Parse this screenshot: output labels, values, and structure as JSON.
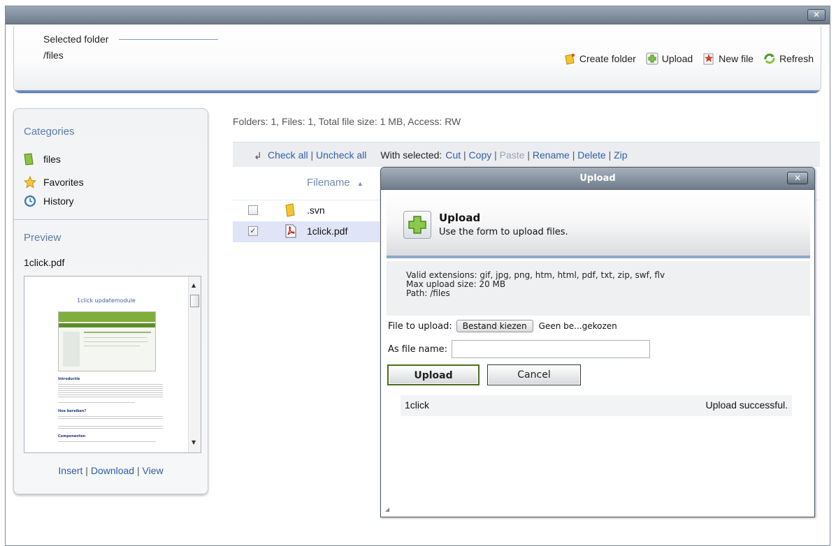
{
  "window": {
    "close_label": "✕"
  },
  "header": {
    "selected_folder_label": "Selected folder",
    "selected_folder_value": "/files",
    "toolbar": {
      "create_folder": "Create folder",
      "upload": "Upload",
      "new_file": "New file",
      "refresh": "Refresh"
    }
  },
  "sidebar": {
    "categories_title": "Categories",
    "items": [
      {
        "label": "files",
        "icon": "folder-icon"
      },
      {
        "label": "Favorites",
        "icon": "star-icon"
      },
      {
        "label": "History",
        "icon": "clock-icon"
      }
    ],
    "preview_title": "Preview",
    "preview_file": "1click.pdf",
    "preview_doc": {
      "heading": "1click updatemodule",
      "section1": "Introductie",
      "section2": "Hoe bereiken?",
      "section3": "Componenten"
    },
    "preview_links": {
      "insert": "Insert",
      "download": "Download",
      "view": "View"
    }
  },
  "main": {
    "summary": "Folders: 1, Files: 1, Total file size: 1 MB, Access: RW",
    "actions": {
      "check_all": "Check all",
      "uncheck_all": "Uncheck all",
      "with_selected": "With selected:",
      "cut": "Cut",
      "copy": "Copy",
      "paste": "Paste",
      "rename": "Rename",
      "delete": "Delete",
      "zip": "Zip"
    },
    "table": {
      "column_filename": "Filename",
      "sort_indicator": "▲",
      "rows": [
        {
          "name": ".svn",
          "checked": false,
          "icon": "folder-icon"
        },
        {
          "name": "1click.pdf",
          "checked": true,
          "icon": "pdf-icon"
        }
      ]
    }
  },
  "dialog": {
    "title": "Upload",
    "close_label": "✕",
    "heading": "Upload",
    "subheading": "Use the form to upload files.",
    "valid_extensions": "Valid extensions: gif, jpg, png, htm, html, pdf, txt, zip, swf, flv",
    "max_size": "Max upload size: 20 MB",
    "path": "Path: /files",
    "file_to_upload_label": "File to upload:",
    "choose_button": "Bestand kiezen",
    "chosen_text": "Geen be...gekozen",
    "as_file_name_label": "As file name:",
    "as_file_name_value": "",
    "upload_button": "Upload",
    "cancel_button": "Cancel",
    "result_name": "1click",
    "result_status": "Upload successful."
  }
}
